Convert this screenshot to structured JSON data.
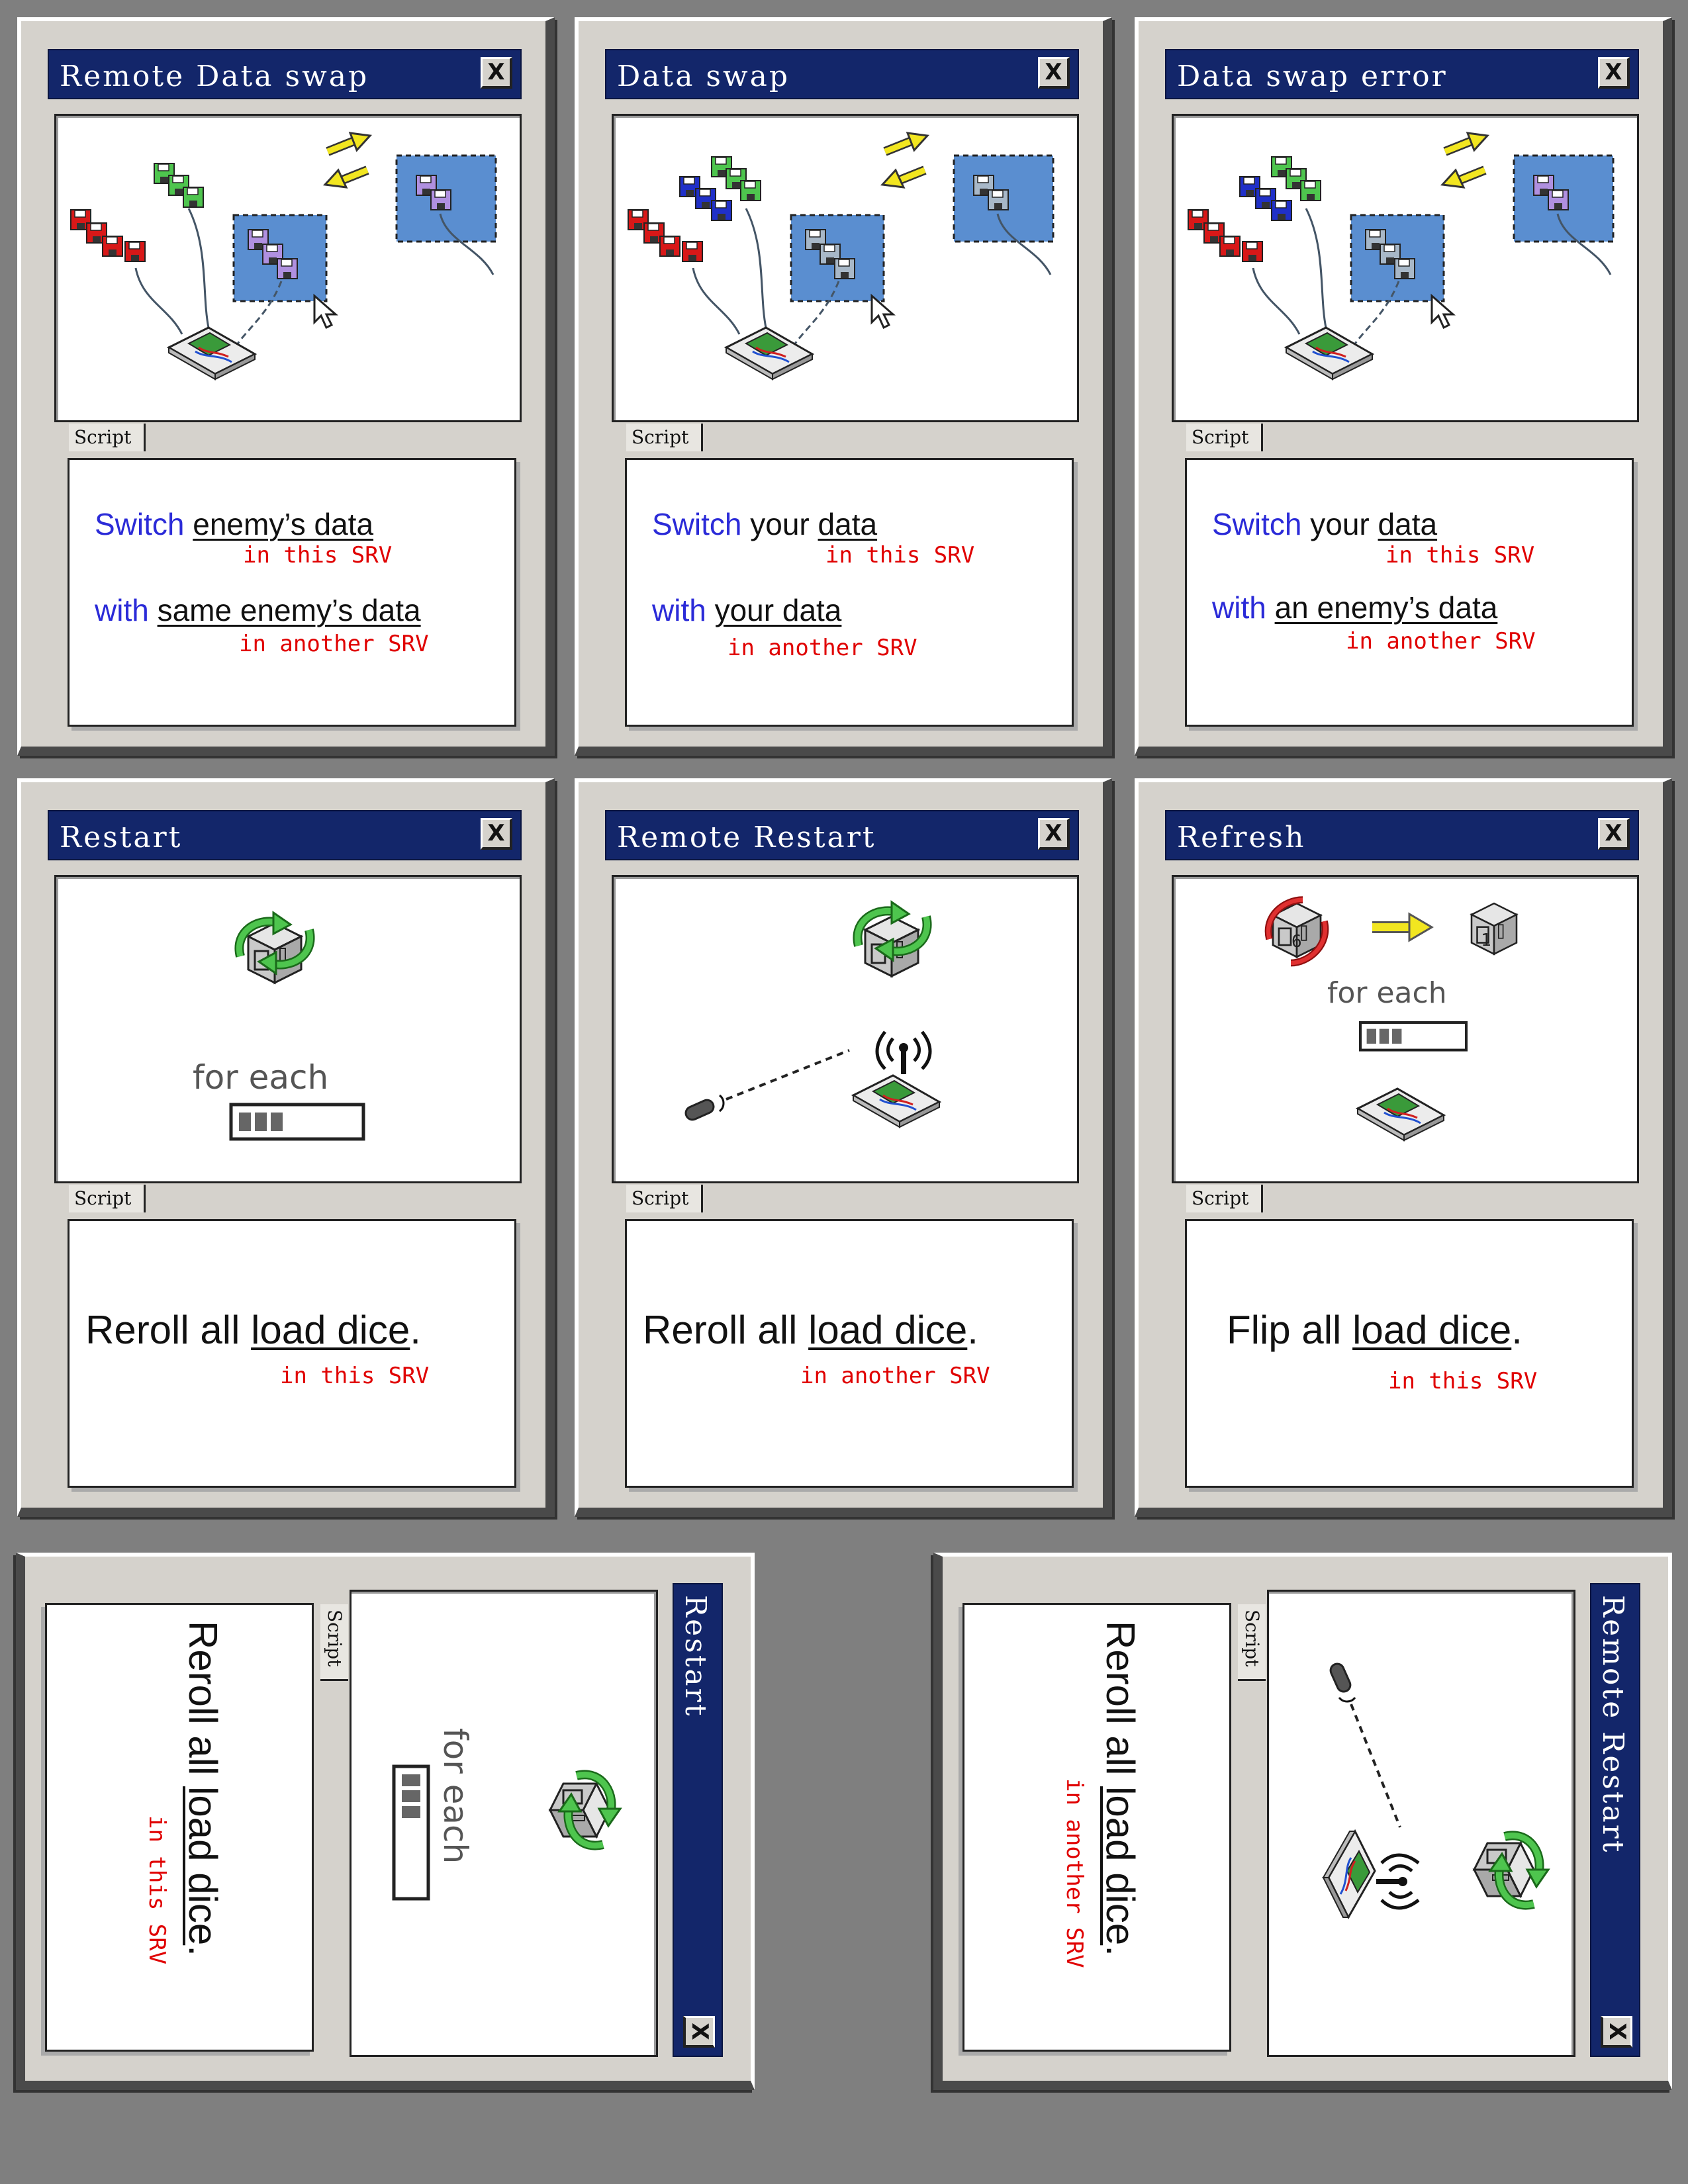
{
  "cards": {
    "remote_data_swap": {
      "title": "Remote Data swap",
      "close": "X",
      "script_tab": "Script",
      "line1": {
        "keyword": "Switch",
        "object": "enemy’s data",
        "location": "in this SRV"
      },
      "line2": {
        "keyword": "with",
        "object": "same enemy’s data",
        "location": "in another SRV"
      }
    },
    "data_swap": {
      "title": "Data swap",
      "close": "X",
      "script_tab": "Script",
      "line1": {
        "keyword": "Switch",
        "plain": "your",
        "object": "data",
        "location": "in this SRV"
      },
      "line2": {
        "keyword": "with",
        "object": "your data",
        "location": "in another SRV"
      }
    },
    "data_swap_error": {
      "title": "Data swap error",
      "close": "X",
      "script_tab": "Script",
      "line1": {
        "keyword": "Switch",
        "plain": "your",
        "object": "data",
        "location": "in this SRV"
      },
      "line2": {
        "keyword": "with",
        "object": "an enemy’s data",
        "location": "in another SRV"
      }
    },
    "restart": {
      "title": "Restart",
      "close": "X",
      "script_tab": "Script",
      "art_label": "for each",
      "text": {
        "verb": "Reroll all",
        "object": "load dice",
        "end": ".",
        "location": "in this SRV"
      }
    },
    "remote_restart": {
      "title": "Remote Restart",
      "close": "X",
      "script_tab": "Script",
      "text": {
        "verb": "Reroll all",
        "object": "load dice",
        "end": ".",
        "location": "in another SRV"
      }
    },
    "refresh": {
      "title": "Refresh",
      "close": "X",
      "script_tab": "Script",
      "art_label": "for each",
      "die_before": "6",
      "die_after": "1",
      "text": {
        "verb": "Flip all",
        "object": "load dice",
        "end": ".",
        "location": "in this SRV"
      }
    },
    "restart_rotated": {
      "title": "Restart",
      "close": "X",
      "script_tab": "Script",
      "art_label": "for each",
      "text": {
        "verb": "Reroll all",
        "object": "load dice",
        "end": ".",
        "location": "in this SRV"
      }
    },
    "remote_restart_rotated": {
      "title": "Remote Restart",
      "close": "X",
      "script_tab": "Script",
      "text": {
        "verb": "Reroll all",
        "object": "load dice",
        "end": ".",
        "location": "in another SRV"
      }
    }
  },
  "colors": {
    "titlebar": "#13266a",
    "keyword": "#2b2bd8",
    "location": "#e00000",
    "disk_red": "#d81818",
    "disk_green": "#4ec54e",
    "disk_blue": "#2030c8",
    "disk_purple": "#b090e0",
    "disk_grey": "#a8b8c8",
    "selection": "#5a8ed0",
    "background": "#7f7f7f"
  },
  "icons": [
    "floppy-disk-icon",
    "swap-arrows-icon",
    "cursor-icon",
    "circuit-board-icon",
    "die-icon",
    "refresh-arrows-icon",
    "progress-bar-icon",
    "antenna-icon",
    "remote-icon"
  ]
}
